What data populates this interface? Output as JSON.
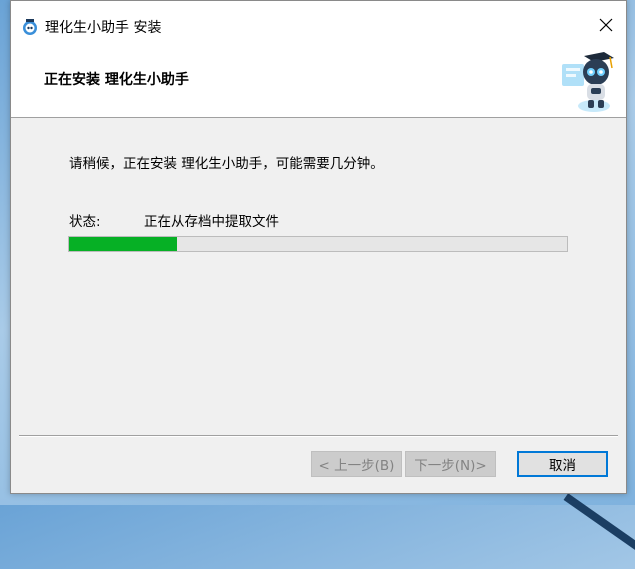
{
  "window": {
    "title": "理化生小助手 安装"
  },
  "header": {
    "title": "正在安装 理化生小助手"
  },
  "content": {
    "message": "请稍候，正在安装 理化生小助手，可能需要几分钟。",
    "status_label": "状态:",
    "status_text": "正在从存档中提取文件",
    "progress_fraction": 0.216
  },
  "buttons": {
    "back": "< 上一步(B)",
    "next": "下一步(N)>",
    "cancel": "取消"
  },
  "colors": {
    "progress_fill": "#06b025",
    "cancel_border": "#0078d7"
  }
}
